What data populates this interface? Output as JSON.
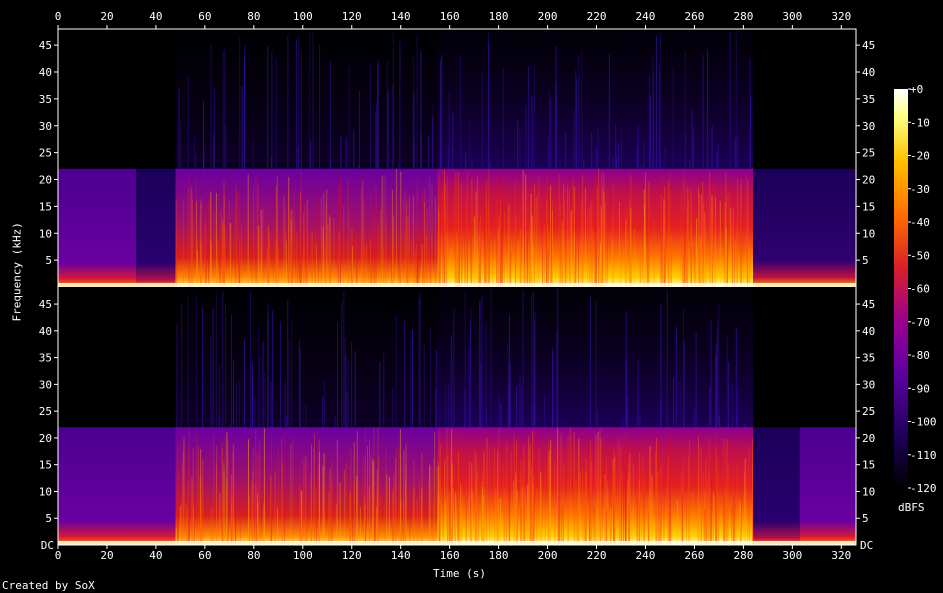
{
  "chart_data": {
    "type": "heatmap",
    "title": "",
    "xlabel": "Time (s)",
    "ylabel": "Frequency (kHz)",
    "xlim": [
      0,
      326
    ],
    "ylim": [
      0,
      48
    ],
    "x_ticks": [
      "0",
      "20",
      "40",
      "60",
      "80",
      "100",
      "120",
      "140",
      "160",
      "180",
      "200",
      "220",
      "240",
      "260",
      "280",
      "300",
      "320"
    ],
    "y_ticks": [
      "5",
      "10",
      "15",
      "20",
      "25",
      "30",
      "35",
      "40",
      "45"
    ],
    "y_tick_values": [
      5,
      10,
      15,
      20,
      25,
      30,
      35,
      40,
      45
    ],
    "dc_label": "DC",
    "colorbar": {
      "unit": "dBFS",
      "range": [
        -120,
        0
      ],
      "tick_labels": [
        "+0",
        "-10",
        "-20",
        "-30",
        "-40",
        "-50",
        "-60",
        "-70",
        "-80",
        "-90",
        "-100",
        "-110",
        "-120"
      ],
      "colors": [
        "#000000",
        "#1a0055",
        "#5a00a0",
        "#9b0090",
        "#d81f2a",
        "#ff6a00",
        "#ffc000",
        "#ffff80",
        "#ffffff"
      ]
    },
    "channels": [
      {
        "name": "",
        "segments": [
          {
            "t0": 0,
            "t1": 32,
            "cutoff_khz": 22,
            "level": "low"
          },
          {
            "t0": 32,
            "t1": 48,
            "cutoff_khz": 22,
            "level": "very-low"
          },
          {
            "t0": 48,
            "t1": 155,
            "cutoff_khz": 22,
            "level": "medium"
          },
          {
            "t0": 155,
            "t1": 284,
            "cutoff_khz": 22,
            "level": "high"
          },
          {
            "t0": 284,
            "t1": 326,
            "cutoff_khz": 22,
            "level": "fade"
          }
        ]
      },
      {
        "name": "",
        "segments": [
          {
            "t0": 0,
            "t1": 48,
            "cutoff_khz": 22,
            "level": "low"
          },
          {
            "t0": 48,
            "t1": 155,
            "cutoff_khz": 22,
            "level": "medium"
          },
          {
            "t0": 155,
            "t1": 284,
            "cutoff_khz": 22,
            "level": "high"
          },
          {
            "t0": 284,
            "t1": 303,
            "cutoff_khz": 22,
            "level": "very-low"
          },
          {
            "t0": 303,
            "t1": 326,
            "cutoff_khz": 22,
            "level": "low"
          }
        ]
      }
    ]
  },
  "credit": "Created by SoX"
}
